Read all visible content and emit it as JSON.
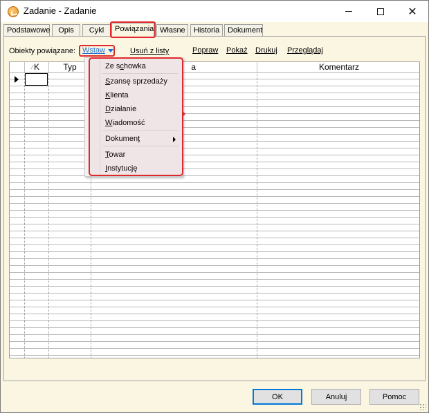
{
  "window": {
    "title": "Zadanie - Zadanie",
    "close_glyph": "✕"
  },
  "tabs": [
    {
      "label": "Podstawowe"
    },
    {
      "label": "Opis"
    },
    {
      "label": "Cykl"
    },
    {
      "label": "Powiązania",
      "active": true
    },
    {
      "label": "Własne"
    },
    {
      "label": "Historia"
    },
    {
      "label": "Dokument"
    }
  ],
  "toolbar": {
    "objects_label": "Obiekty powiązane:",
    "insert_label": "Wstaw",
    "remove_label": "Usuń z listy",
    "edit_label": "Popraw",
    "show_label": "Pokaż",
    "print_label": "Drukuj",
    "browse_label": "Przeglądaj"
  },
  "grid": {
    "columns": [
      {
        "label": ""
      },
      {
        "label": "K"
      },
      {
        "label": "Typ"
      },
      {
        "label": "a"
      },
      {
        "label": "Komentarz"
      }
    ]
  },
  "insert_menu": {
    "items": [
      {
        "pre": "Ze s",
        "ul": "c",
        "post": "howka"
      },
      {
        "pre": "",
        "ul": "S",
        "post": "zansę sprzedaży"
      },
      {
        "pre": "",
        "ul": "K",
        "post": "lienta"
      },
      {
        "pre": "",
        "ul": "D",
        "post": "ziałanie"
      },
      {
        "pre": "",
        "ul": "W",
        "post": "iadomość"
      },
      {
        "pre": "Dokumen",
        "ul": "t",
        "post": ""
      },
      {
        "pre": "",
        "ul": "T",
        "post": "owar"
      },
      {
        "pre": "",
        "ul": "I",
        "post": "nstytucję"
      }
    ]
  },
  "buttons": {
    "ok": "OK",
    "cancel": "Anuluj",
    "help": "Pomoc"
  },
  "colors": {
    "highlight": "#e0282c",
    "link_active": "#1a6fd1",
    "background": "#fbf6e2"
  }
}
